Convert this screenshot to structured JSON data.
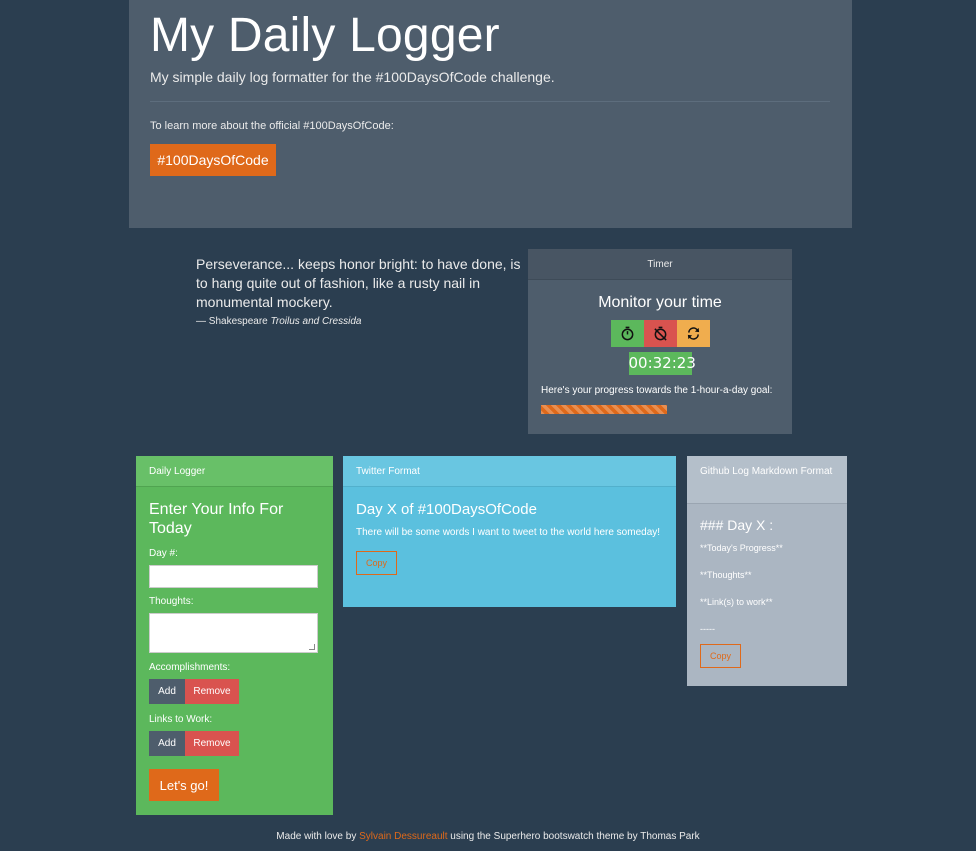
{
  "jumbotron": {
    "title": "My Daily Logger",
    "subtitle": "My simple daily log formatter for the #100DaysOfCode challenge.",
    "learn_text": "To learn more about the official #100DaysOfCode:",
    "button_label": "#100DaysOfCode"
  },
  "quote": {
    "text": "Perseverance... keeps honor bright: to have done, is to hang quite out of fashion, like a rusty nail in monumental mockery.",
    "author_prefix": "— Shakespeare ",
    "work": "Troilus and Cressida"
  },
  "timer": {
    "heading": "Timer",
    "title": "Monitor your time",
    "buttons": {
      "start_icon": "stopwatch-icon",
      "stop_icon": "timer-off-icon",
      "reset_icon": "refresh-icon"
    },
    "clock": "00:32:23",
    "progress_label": "Here's your progress towards the 1-hour-a-day goal:",
    "progress_percent": 53,
    "colors": {
      "start": "#5cb85c",
      "stop": "#d9534f",
      "reset": "#f0ad4e",
      "progress": "#df691a"
    }
  },
  "logger": {
    "heading": "Daily Logger",
    "title": "Enter Your Info For Today",
    "day_label": "Day #:",
    "day_value": "",
    "thoughts_label": "Thoughts:",
    "thoughts_value": "",
    "accomplishments_label": "Accomplishments:",
    "links_label": "Links to Work:",
    "add_label": "Add",
    "remove_label": "Remove",
    "go_label": "Let's go!"
  },
  "twitter": {
    "heading": "Twitter Format",
    "title": "Day X of #100DaysOfCode",
    "body": "There will be some words I want to tweet to the world here someday!",
    "copy_label": "Copy"
  },
  "github": {
    "heading": "Github Log Markdown Format",
    "title": "### Day X :",
    "lines": [
      "**Today's Progress**",
      "**Thoughts**",
      "**Link(s) to work**",
      "-----"
    ],
    "copy_label": "Copy"
  },
  "footer": {
    "prefix": "Made with love by ",
    "author": "Sylvain Dessureault",
    "suffix": " using the Superhero bootswatch theme by Thomas Park"
  },
  "colors": {
    "background": "#2b3e50",
    "accent": "#df691a",
    "panel_dark": "#4e5d6c",
    "success": "#5cb85c",
    "info": "#5bc0de",
    "default": "#abb6c2"
  }
}
